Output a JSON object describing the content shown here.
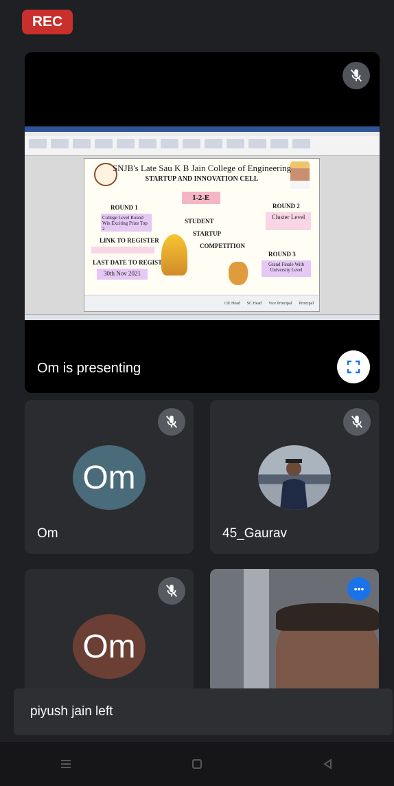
{
  "rec_label": "REC",
  "presentation": {
    "status": "Om is presenting",
    "slide": {
      "college": "SNJB's Late Sau K B Jain College of Engineering",
      "cell": "STARTUP AND INNOVATION CELL",
      "badge": "I-2-E",
      "round1": "ROUND 1",
      "round1_desc": "College Level Round Win Exciting Prize Top 2",
      "link_label": "LINK TO REGISTER",
      "last_date_label": "LAST DATE TO REGISTER",
      "last_date": "30th Nov 2021",
      "center1": "STUDENT",
      "center2": "STARTUP",
      "center3": "COMPETITION",
      "round2": "ROUND 2",
      "round2_desc": "Cluster Level",
      "round3": "ROUND 3",
      "round3_desc": "Grand Finale With University Level",
      "footer_names": [
        "CiE Head",
        "SC Head",
        "Vice Principal",
        "Principal"
      ]
    }
  },
  "participants": [
    {
      "name": "Om",
      "initials": "Om",
      "avatar_color": "#4a6b7a"
    },
    {
      "name": "45_Gaurav"
    },
    {
      "initials": "Om",
      "avatar_color": "#6b3f34"
    }
  ],
  "toast": "piyush jain left",
  "icons": {
    "mic": "mic-off-icon",
    "fullscreen": "fullscreen-icon",
    "nav": [
      "recents-icon",
      "home-icon",
      "back-icon"
    ]
  }
}
